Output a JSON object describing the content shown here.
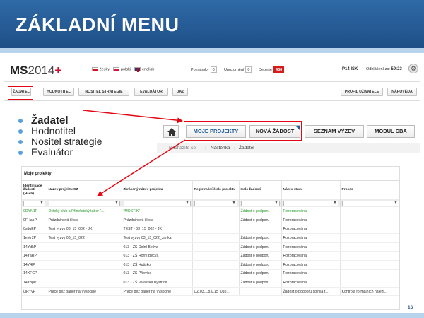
{
  "slide": {
    "title": "ZÁKLADNÍ MENU",
    "page_number": "16"
  },
  "app_header": {
    "logo_ms": "MS",
    "logo_year": "2014",
    "logo_plus": "+",
    "languages": [
      "česky",
      "polski",
      "english"
    ],
    "counters": [
      {
        "label": "Poznámky",
        "value": "0"
      },
      {
        "label": "Upozornění",
        "value": "0"
      },
      {
        "label": "Depeše",
        "value": "486"
      }
    ],
    "user": "P14 ISK",
    "logout_label": "Odhlášení za:",
    "logout_time": "59:23"
  },
  "nav": {
    "left": [
      "ŽADATEL",
      "HODNOTITEL",
      "NOSITEL STRATEGIE",
      "EVALUÁTOR",
      "DAZ"
    ],
    "right": [
      "PROFIL UŽIVATELE",
      "NÁPOVĚDA"
    ]
  },
  "bullets": [
    "Žadatel",
    "Hodnotitel",
    "Nositel strategie",
    "Evaluátor"
  ],
  "zoom": {
    "buttons": [
      "MOJE PROJEKTY",
      "NOVÁ ŽÁDOST",
      "SEZNAM VÝZEV",
      "MODUL CBA"
    ],
    "breadcrumb_label": "Nacházíte se:",
    "breadcrumbs": [
      "Nástěnka",
      "Žadatel"
    ]
  },
  "table": {
    "title": "Moje projekty",
    "headers": [
      "Identifikace žádosti (Hash)",
      "Název projektu CZ",
      "Zkrácený název projektu",
      "Registrační číslo projektu",
      "Kolo žádosti",
      "Název stavu",
      "Proces"
    ],
    "rows": [
      [
        "0DYN1P",
        "Dětský klub a Příměstský tábor \"...",
        "\"MOSTÍK\"",
        "",
        "Žádost o podporu",
        "Rozpracována",
        ""
      ],
      [
        "0FHapP",
        "Prázdninová škola",
        "Prázdninová škola",
        "",
        "Žádost o podporu",
        "Rozpracována",
        ""
      ],
      [
        "0sdgEP",
        "Test výzvy 03_15_002 - JK",
        "TEST - 03_15_002 - JK",
        "",
        "",
        "Rozpracována",
        ""
      ],
      [
        "1eMr2P",
        "Test výzvy 03_15_022",
        "Test výzvy 03_15_022_Janka",
        "",
        "Žádost o podporu",
        "Rozpracována",
        ""
      ],
      [
        "14YdkP",
        "",
        "013 - ZŠ Dolní Bečva",
        "",
        "Žádost o podporu",
        "Rozpracována",
        ""
      ],
      [
        "14YaRP",
        "",
        "013 - ZŠ Horní Bečva",
        "",
        "Žádost o podporu",
        "Rozpracována",
        ""
      ],
      [
        "14Y4lP",
        "",
        "013 - ZŠ Hutisko",
        "",
        "Žádost o podporu",
        "Rozpracována",
        ""
      ],
      [
        "14XFCP",
        "",
        "013 - ZŠ Přiovice",
        "",
        "Žádost o podporu",
        "Rozpracována",
        ""
      ],
      [
        "14Y8pP",
        "",
        "013 - ZŠ Valašská Bystřice",
        "",
        "Žádost o podporu",
        "Rozpracována",
        ""
      ],
      [
        "0lRYyP",
        "Práce bez bariér na Vysočině",
        "Práce bez bariér na Vysočině",
        "CZ.03.1.8.0.15_010...",
        "",
        "Žádost o podporu splnila f...",
        "Kontrola formálních náleži..."
      ]
    ]
  },
  "colors": {
    "header_blue": "#1e4f86",
    "highlight_red": "#e30613",
    "bullet_blue": "#5aa0dc",
    "green_text": "#2d9b2d"
  }
}
